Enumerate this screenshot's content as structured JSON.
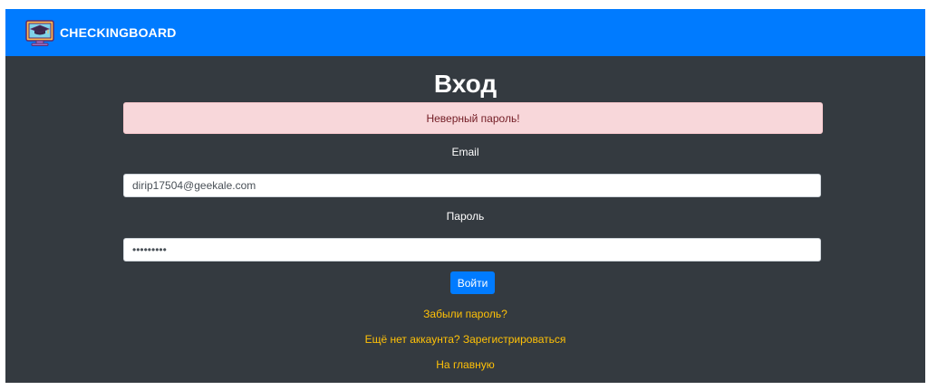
{
  "navbar": {
    "brand": "CHECKINGBOARD",
    "logo_icon": "graduation-cap-monitor-icon",
    "color": "#007bff"
  },
  "page": {
    "title": "Вход",
    "background": "#343a40"
  },
  "alert": {
    "message": "Неверный пароль!",
    "background": "#f8d7da",
    "text_color": "#721c24"
  },
  "form": {
    "email_label": "Email",
    "email_value": "dirip17504@geekale.com",
    "password_label": "Пароль",
    "password_value": "123456789",
    "submit_label": "Войти"
  },
  "links": {
    "forgot": "Забыли пароль?",
    "register": "Ещё нет аккаунта? Зарегистрироваться",
    "home": "На главную",
    "color": "#ffc107"
  }
}
